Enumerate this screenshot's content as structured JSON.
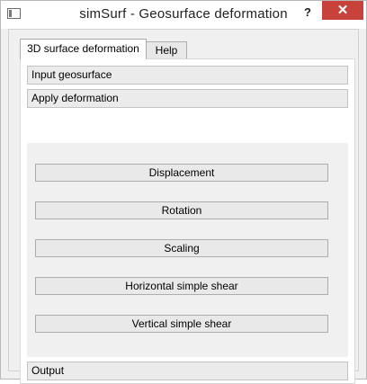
{
  "window": {
    "title": "simSurf - Geosurface deformation",
    "help_label": "?",
    "close_label": "✕"
  },
  "tabs": [
    {
      "label": "3D surface deformation",
      "active": true
    },
    {
      "label": "Help",
      "active": false
    }
  ],
  "sections": {
    "input": "Input geosurface",
    "apply": "Apply deformation",
    "output": "Output"
  },
  "buttons": {
    "displacement": "Displacement",
    "rotation": "Rotation",
    "scaling": "Scaling",
    "horizontal_shear": "Horizontal simple shear",
    "vertical_shear": "Vertical simple shear"
  }
}
